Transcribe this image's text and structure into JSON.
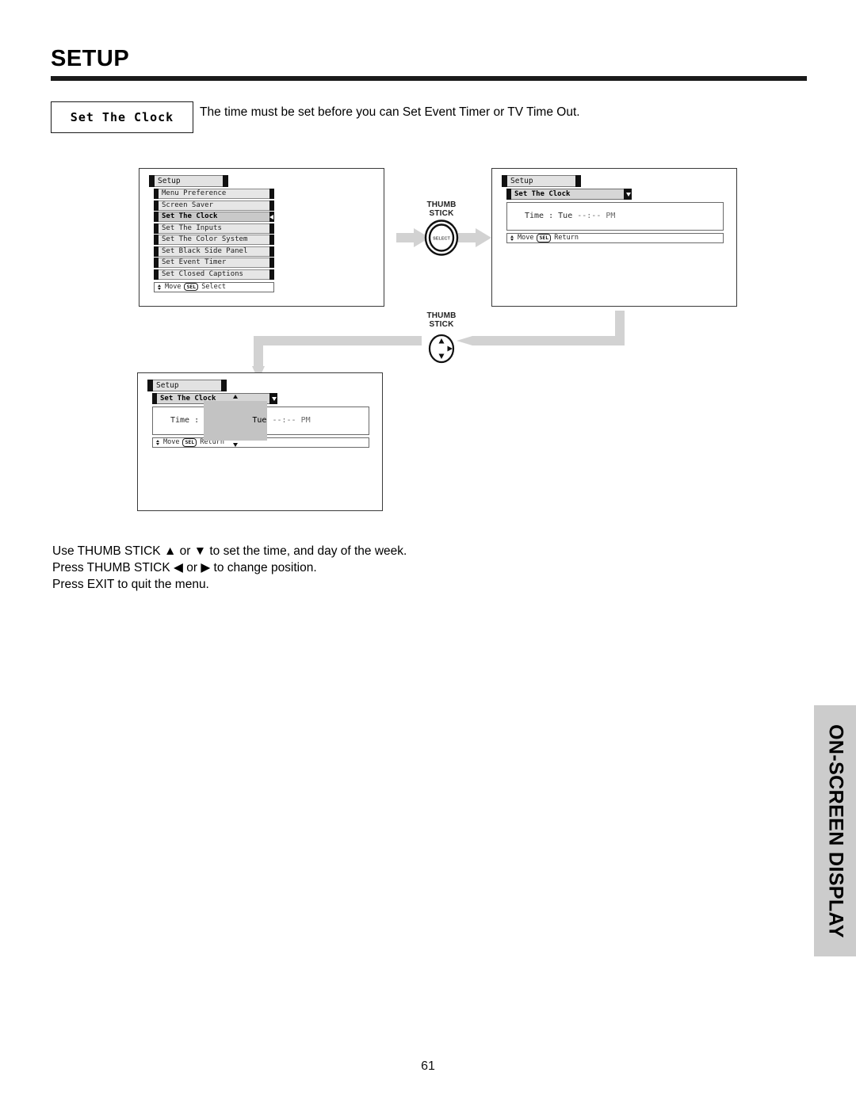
{
  "page": {
    "title": "SETUP",
    "number": "61",
    "side_tab": "ON-SCREEN DISPLAY"
  },
  "section": {
    "label": "Set The Clock",
    "caption": "The time must be set before you can Set Event Timer or TV Time Out."
  },
  "panels": {
    "menu": {
      "osd_title": "Setup",
      "items": [
        {
          "label": "Menu Preference",
          "selected": false
        },
        {
          "label": "Screen Saver",
          "selected": false
        },
        {
          "label": "Set The Clock",
          "selected": true
        },
        {
          "label": "Set The Inputs",
          "selected": false
        },
        {
          "label": "Set The Color System",
          "selected": false
        },
        {
          "label": "Set Black Side Panel",
          "selected": false
        },
        {
          "label": "Set Event Timer",
          "selected": false
        },
        {
          "label": "Set Closed Captions",
          "selected": false
        }
      ],
      "footer": {
        "move": "Move",
        "key": "SEL",
        "action": "Select"
      }
    },
    "clock": {
      "osd_title": "Setup",
      "dropdown": "Set The Clock",
      "time": {
        "prefix": "Time : ",
        "day": "Tue",
        "value": " --:-- PM"
      },
      "footer": {
        "move": "Move",
        "key": "SEL",
        "action": "Return"
      }
    },
    "edit": {
      "osd_title": "Setup",
      "dropdown": "Set The Clock",
      "time": {
        "prefix": "Time : ",
        "day": "Tue",
        "value": " --:-- PM"
      },
      "footer": {
        "move": "Move",
        "key": "SEL",
        "action": "Return"
      }
    }
  },
  "controls": {
    "thumbstick_select": {
      "line1": "THUMB",
      "line2": "STICK",
      "center": "SELECT"
    },
    "thumbstick_nav": {
      "line1": "THUMB",
      "line2": "STICK"
    }
  },
  "instructions": [
    "Use THUMB STICK ▲ or ▼ to set the time, and day of the week.",
    "Press THUMB STICK ◀ or ▶ to change position.",
    "Press EXIT to quit the menu."
  ],
  "colors": {
    "rule": "#1a1a1a",
    "side_tab_bg": "#cccccc",
    "arrow": "#d2d2d2",
    "osd_row_bg": "#e6e6e6",
    "osd_selected_bg": "#c9c9c9"
  }
}
